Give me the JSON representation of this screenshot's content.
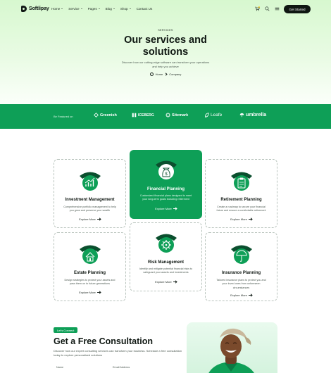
{
  "brand": {
    "name": "Softlipay",
    "accent": "#0e9f57",
    "dark": "#0f1712"
  },
  "nav": {
    "items": [
      {
        "label": "Home",
        "dropdown": true
      },
      {
        "label": "Service",
        "dropdown": true
      },
      {
        "label": "Pages",
        "dropdown": true
      },
      {
        "label": "Blog",
        "dropdown": true
      },
      {
        "label": "Shop",
        "dropdown": true
      },
      {
        "label": "Contact Us",
        "dropdown": false
      }
    ],
    "icons": [
      "cart-icon",
      "search-icon",
      "menu-icon"
    ],
    "cta_label": "Get Started"
  },
  "hero": {
    "eyebrow": "SERVICES",
    "title_line1": "Our services and",
    "title_line2": "solutions",
    "subtitle": "Discover how our cutting-edge software can transform your operations and help you achieve",
    "breadcrumb": {
      "home": "Home",
      "current": "Company"
    }
  },
  "partners": {
    "label": "Be Featured on",
    "logos": [
      "Greenish",
      "ICEBERG",
      "Sitemark",
      "Leafe",
      "umbrella"
    ]
  },
  "services": [
    {
      "title": "Investment Management",
      "description": "Comprehensive portfolio management to help you grow and preserve your wealth",
      "link": "Explore More",
      "icon": "growth-chart-icon",
      "featured": false
    },
    {
      "title": "Financial Planning",
      "description": "Customized financial plans designed to meet your long-term goals including retirement",
      "link": "Explore More",
      "icon": "money-bag-icon",
      "featured": true
    },
    {
      "title": "Retirement Planning",
      "description": "Create a roadmap to secure your financial future and ensure a comfortable retirement",
      "link": "Explore More",
      "icon": "clipboard-icon",
      "featured": false
    },
    {
      "title": "Estate Planning",
      "description": "Design strategies to protect your assets and pass them on to future generations",
      "link": "Explore More",
      "icon": "estate-icon",
      "featured": false
    },
    {
      "title": "Risk Management",
      "description": "Identify and mitigate potential financial risks to safeguard your assets and investments",
      "link": "Explore More",
      "icon": "risk-gear-icon",
      "featured": false
    },
    {
      "title": "Insurance Planning",
      "description": "Tailored insurance plans to protect you and your loved ones from unforeseen circumstances",
      "link": "Explore More",
      "icon": "insurance-icon",
      "featured": false
    }
  ],
  "consultation": {
    "tag": "Let's Connect",
    "title": "Get a Free Consultation",
    "subtitle": "Discover how our expert consulting services can transform your business. Schedule a free consultation today to explore personalized solutions",
    "fields": {
      "name_label": "Name",
      "email_label": "Email Address"
    }
  }
}
